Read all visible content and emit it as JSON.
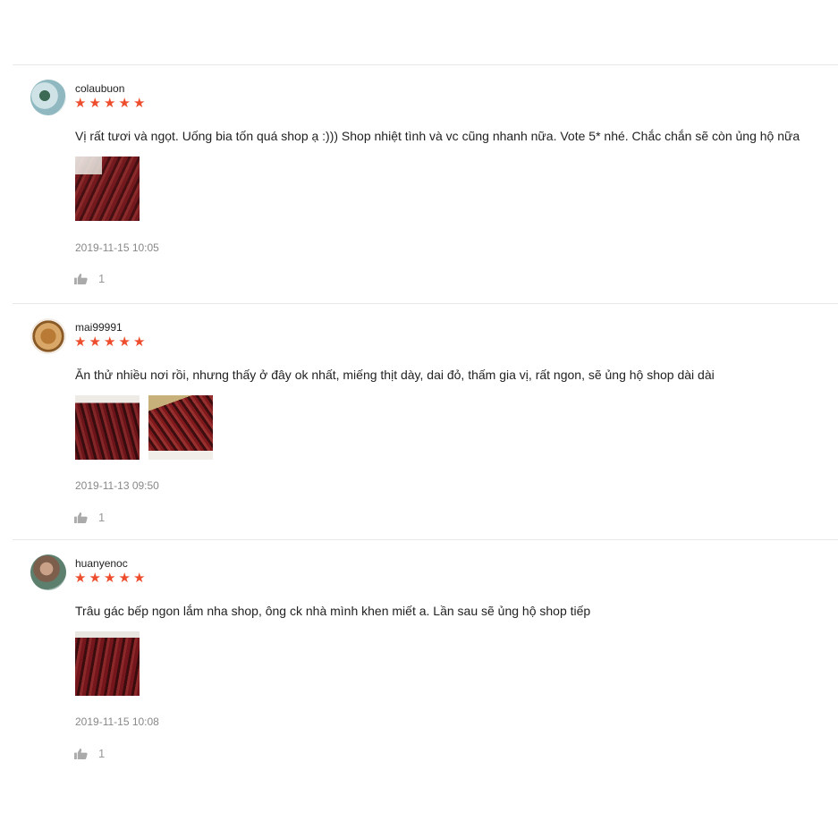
{
  "colors": {
    "star": "#ee4d2d",
    "divider": "#e8e8e8",
    "muted": "#888888"
  },
  "reviews": [
    {
      "username": "colaubuon",
      "rating": 5,
      "comment": "Vị rất tươi và ngọt. Uống bia tốn quá shop ạ :))) Shop nhiệt tình và vc cũng nhanh nữa. Vote 5* nhé. Chắc chắn sẽ còn ủng hộ nữa",
      "timestamp": "2019-11-15 10:05",
      "likes": "1"
    },
    {
      "username": "mai99991",
      "rating": 5,
      "comment": "Ăn thử nhiều nơi rồi, nhưng thấy ở đây ok nhất, miếng thịt dày, dai đỏ, thấm gia vị, rất ngon, sẽ ủng hộ shop dài dài",
      "timestamp": "2019-11-13 09:50",
      "likes": "1"
    },
    {
      "username": "huanyenoc",
      "rating": 5,
      "comment": "Trâu gác bếp ngon lắm nha shop, ông ck nhà mình khen miết a. Lần sau sẽ ủng hộ shop tiếp",
      "timestamp": "2019-11-15 10:08",
      "likes": "1"
    }
  ],
  "icons": {
    "star": "star-icon",
    "like": "thumbs-up-icon"
  }
}
